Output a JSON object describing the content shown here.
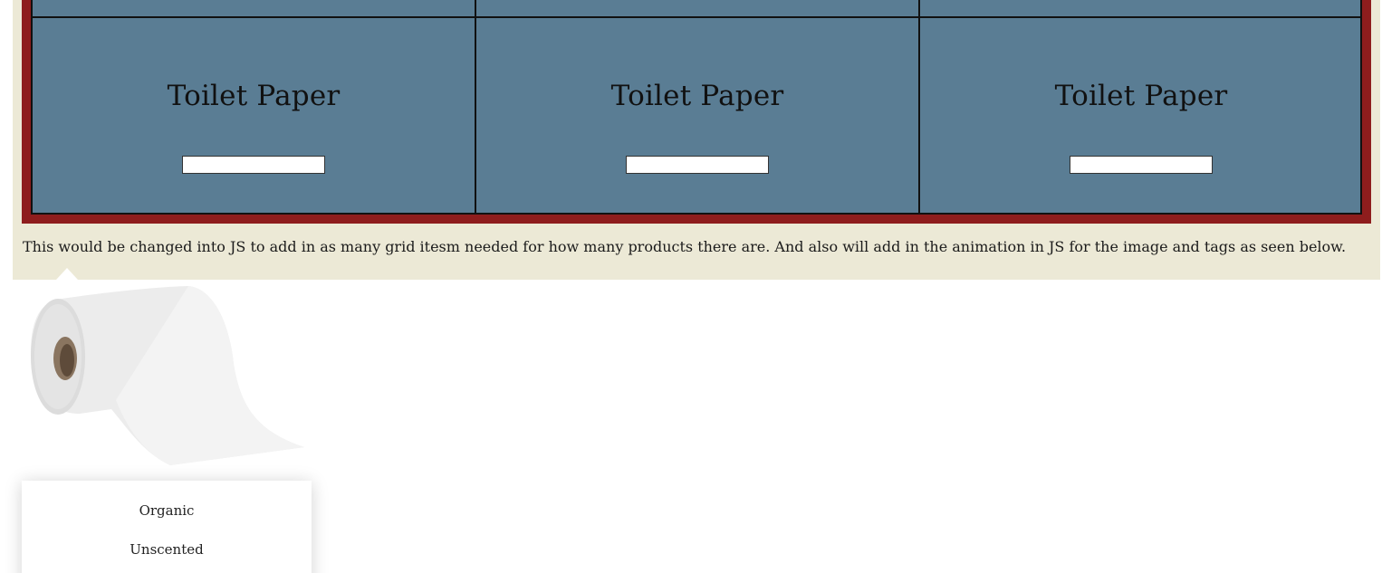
{
  "grid": {
    "items": [
      {
        "title": "Toilet Paper"
      },
      {
        "title": "Toilet Paper"
      },
      {
        "title": "Toilet Paper"
      }
    ]
  },
  "note": "This would be changed into JS to add in as many grid itesm needed for how many products there are. And also will add in the animation in JS for the image and tags as seen below.",
  "product": {
    "image_icon": "toilet-paper-roll-image",
    "tags": [
      "Organic",
      "Unscented"
    ]
  },
  "colors": {
    "cream": "#ece9d6",
    "frame": "#8e1d1d",
    "cell": "#5a7d94"
  }
}
